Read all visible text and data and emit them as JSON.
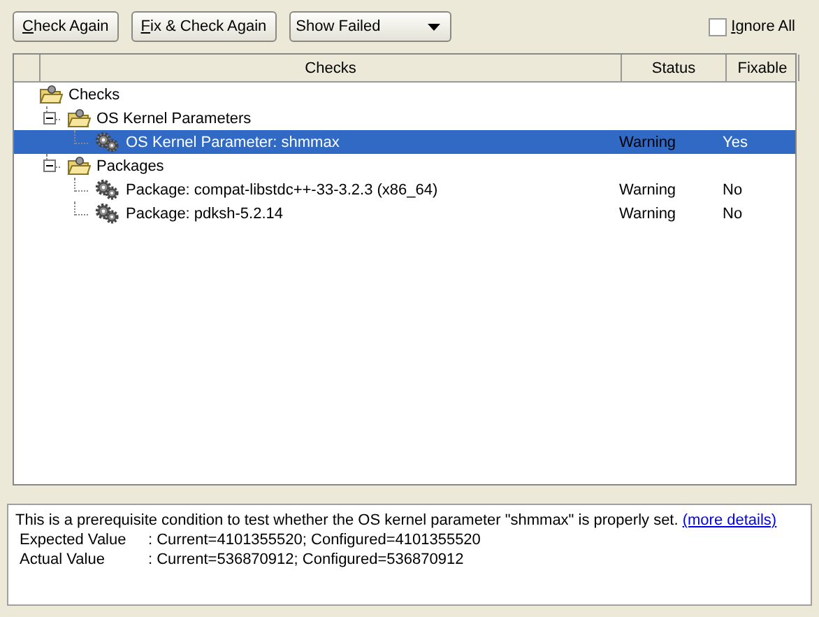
{
  "toolbar": {
    "buttons": [
      {
        "label": "Check Again"
      },
      {
        "label": "Fix & Check Again"
      }
    ],
    "filter": {
      "value": "Show Failed"
    },
    "ignore_all": {
      "label": "Ignore All",
      "checked": false
    }
  },
  "table": {
    "columns": [
      "Checks",
      "Status",
      "Fixable"
    ],
    "tree": [
      {
        "label": "Checks",
        "kind": "folder",
        "selected": false,
        "children": [
          {
            "label": "OS Kernel Parameters",
            "kind": "folder",
            "expanded": true,
            "selected": false,
            "children": [
              {
                "label": "OS Kernel Parameter: shmmax",
                "kind": "check",
                "selected": true,
                "status": "Warning",
                "fixable": "Yes"
              }
            ]
          },
          {
            "label": "Packages",
            "kind": "folder",
            "expanded": true,
            "selected": false,
            "children": [
              {
                "label": "Package: compat-libstdc++-33-3.2.3 (x86_64)",
                "kind": "check",
                "selected": false,
                "status": "Warning",
                "fixable": "No"
              },
              {
                "label": "Package: pdksh-5.2.14",
                "kind": "check",
                "selected": false,
                "status": "Warning",
                "fixable": "No"
              }
            ]
          }
        ]
      }
    ]
  },
  "details": {
    "description": "This is a prerequisite condition to test whether the OS kernel parameter \"shmmax\" is properly set.",
    "link": "(more details)",
    "values": [
      {
        "name": "Expected Value",
        "value": ": Current=4101355520; Configured=4101355520"
      },
      {
        "name": "Actual Value",
        "value": ": Current=536870912; Configured=536870912"
      }
    ]
  }
}
